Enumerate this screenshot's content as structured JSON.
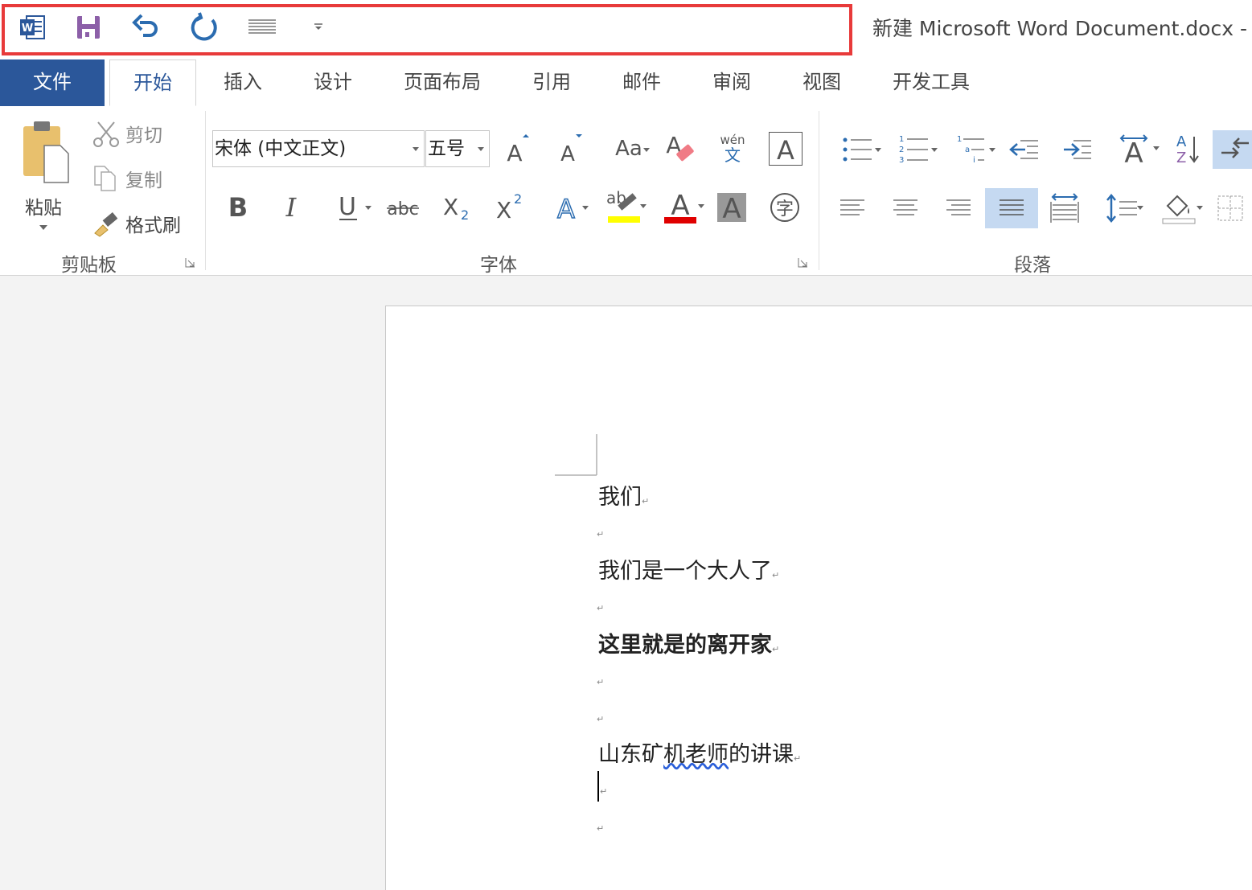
{
  "window": {
    "title": "新建 Microsoft Word Document.docx -"
  },
  "quick_access": {
    "icons": [
      "word-app-icon",
      "save-icon",
      "undo-icon",
      "redo-icon",
      "touch-mode-icon",
      "customize-dropdown-icon"
    ]
  },
  "tabs": [
    {
      "label": "文件"
    },
    {
      "label": "开始"
    },
    {
      "label": "插入"
    },
    {
      "label": "设计"
    },
    {
      "label": "页面布局"
    },
    {
      "label": "引用"
    },
    {
      "label": "邮件"
    },
    {
      "label": "审阅"
    },
    {
      "label": "视图"
    },
    {
      "label": "开发工具"
    }
  ],
  "clipboard": {
    "paste": "粘贴",
    "cut": "剪切",
    "copy": "复制",
    "format_painter": "格式刷",
    "group_label": "剪贴板"
  },
  "font": {
    "name": "宋体 (中文正文)",
    "size": "五号",
    "group_label": "字体",
    "change_case": "Aa",
    "phonetic_top": "wén",
    "phonetic_bottom": "文",
    "enclose_char": "字",
    "highlight_color": "#ffff00",
    "font_color": "#e00000"
  },
  "paragraph": {
    "group_label": "段落"
  },
  "colors": {
    "accent": "#2b579a",
    "qat_highlight": "#e83a3a"
  },
  "document": {
    "paragraphs": [
      {
        "text": "我们",
        "bold": false
      },
      {
        "text": "我们是一个大人了",
        "bold": false
      },
      {
        "text": "这里就是的离开家",
        "bold": true
      },
      {
        "text": "山东矿",
        "bold": false,
        "underlined": "机老师",
        "rest": "的讲课"
      }
    ],
    "paragraph_mark": "↵"
  }
}
